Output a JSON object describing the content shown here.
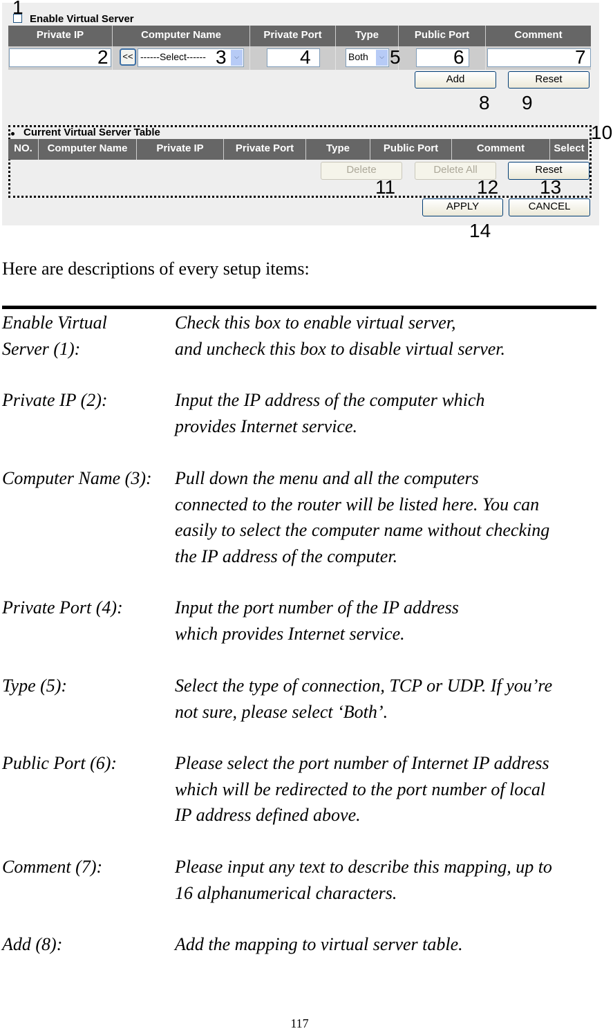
{
  "screenshot": {
    "enable_checkbox": {
      "label": "Enable Virtual Server",
      "checked": false
    },
    "entry_table": {
      "headers": [
        "Private IP",
        "Computer Name",
        "Private Port",
        "Type",
        "Public Port",
        "Comment"
      ],
      "private_ip_value": "",
      "copy_button_label": "<<",
      "computer_name_select": "------Select------",
      "private_port_value": "",
      "type_select": "Both",
      "public_port_value": "",
      "comment_value": ""
    },
    "entry_buttons": {
      "add": "Add",
      "reset": "Reset"
    },
    "current_table": {
      "title": "Current Virtual Server Table",
      "headers": [
        "NO.",
        "Computer Name",
        "Private IP",
        "Private Port",
        "Type",
        "Public Port",
        "Comment",
        "Select"
      ],
      "rows": []
    },
    "table_buttons": {
      "delete": "Delete",
      "delete_all": "Delete All",
      "reset": "Reset"
    },
    "footer_buttons": {
      "apply": "APPLY",
      "cancel": "CANCEL"
    },
    "callouts": [
      "1",
      "2",
      "3",
      "4",
      "5",
      "6",
      "7",
      "8",
      "9",
      "10",
      "11",
      "12",
      "13",
      "14"
    ]
  },
  "document": {
    "intro": "Here are descriptions of every setup items:",
    "items": [
      {
        "term_lines": [
          "Enable Virtual",
          "Server (1):"
        ],
        "text_lines": [
          "Check this box to enable virtual server,",
          "and uncheck this box to disable virtual server."
        ]
      },
      {
        "term_lines": [
          "Private IP (2):"
        ],
        "text_lines": [
          "Input the IP address of the computer which",
          "provides Internet service."
        ]
      },
      {
        "term_lines": [
          "Computer Name (3):"
        ],
        "text_lines": [
          "Pull down the menu and all the computers",
          "connected to the router will be listed here. You can",
          "easily to select the computer name without checking",
          "the IP address of the computer."
        ]
      },
      {
        "term_lines": [
          "Private Port (4):"
        ],
        "text_lines": [
          "Input the port number of the IP address",
          "which provides Internet service."
        ]
      },
      {
        "term_lines": [
          "Type (5):"
        ],
        "text_lines": [
          "Select the type of connection, TCP or UDP. If you’re",
          "not sure, please select ‘Both’."
        ]
      },
      {
        "term_lines": [
          "Public Port (6):"
        ],
        "text_lines": [
          "Please select the port number of Internet IP address",
          "which will be redirected to the port number of local",
          "IP address defined above."
        ]
      },
      {
        "term_lines": [
          "Comment (7):"
        ],
        "text_lines": [
          "Please input any text to describe this mapping, up to",
          "16 alphanumerical characters."
        ]
      },
      {
        "term_lines": [
          "Add (8):"
        ],
        "text_lines": [
          "Add the mapping to virtual server table."
        ]
      }
    ],
    "page_number": "117"
  }
}
